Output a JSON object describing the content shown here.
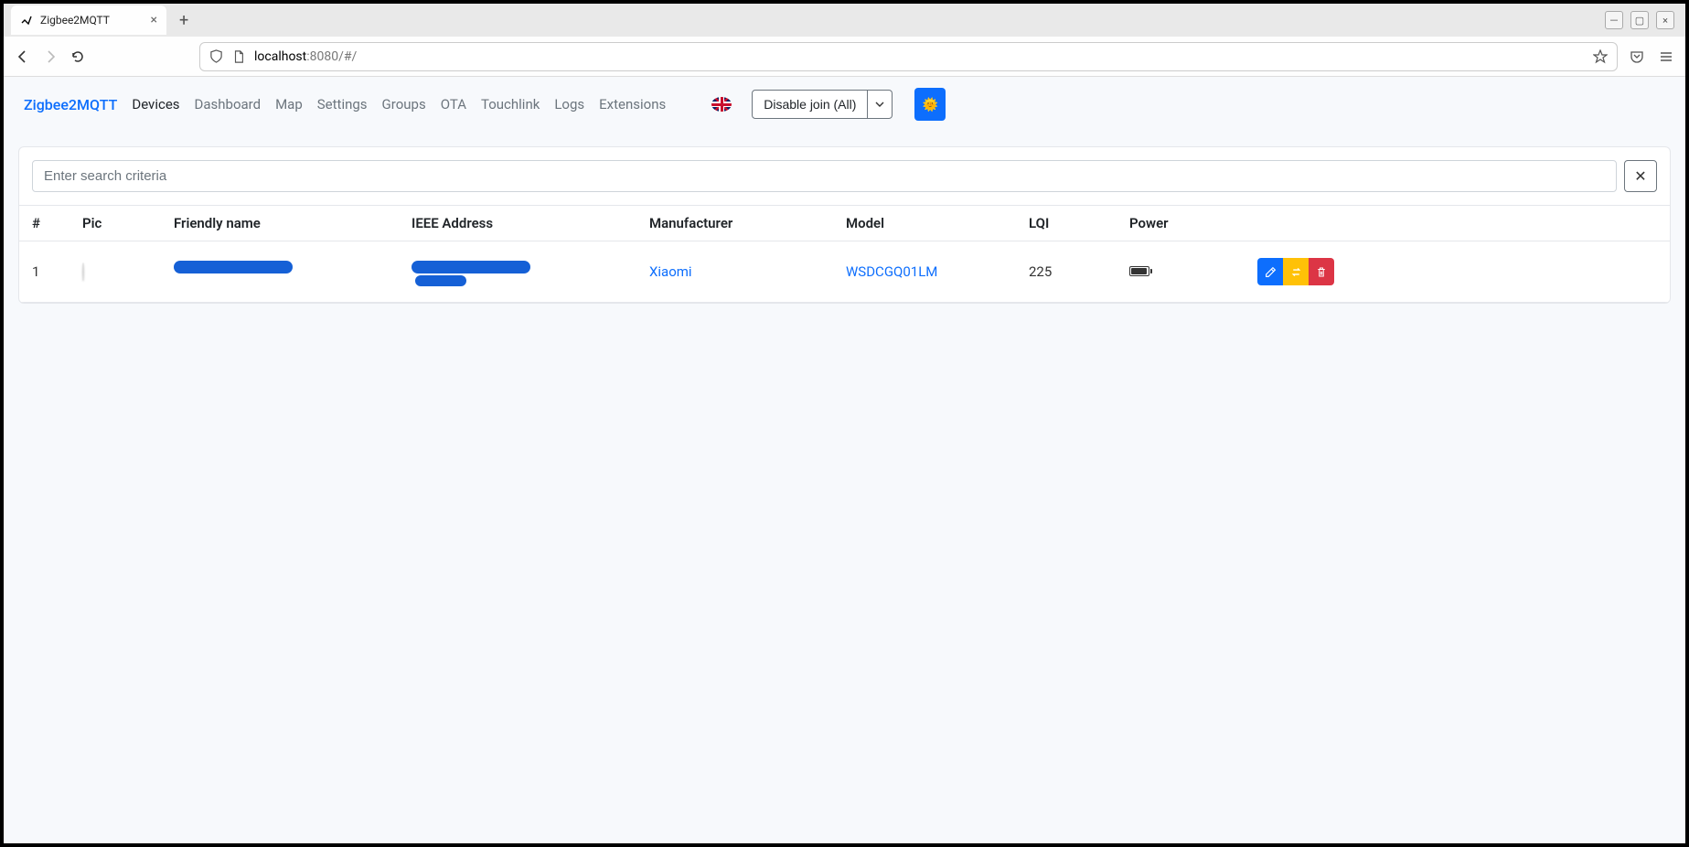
{
  "browser": {
    "tab_title": "Zigbee2MQTT",
    "url_host": "localhost",
    "url_path": ":8080/#/"
  },
  "nav": {
    "brand": "Zigbee2MQTT",
    "items": [
      "Devices",
      "Dashboard",
      "Map",
      "Settings",
      "Groups",
      "OTA",
      "Touchlink",
      "Logs",
      "Extensions"
    ],
    "active_index": 0,
    "permit_join_label": "Disable join (All)",
    "theme_icon": "🌞"
  },
  "search": {
    "placeholder": "Enter search criteria",
    "value": ""
  },
  "columns": {
    "idx": "#",
    "pic": "Pic",
    "name": "Friendly name",
    "ieee": "IEEE Address",
    "mfr": "Manufacturer",
    "model": "Model",
    "lqi": "LQI",
    "power": "Power"
  },
  "devices": [
    {
      "idx": "1",
      "manufacturer": "Xiaomi",
      "model": "WSDCGQ01LM",
      "lqi": "225"
    }
  ]
}
